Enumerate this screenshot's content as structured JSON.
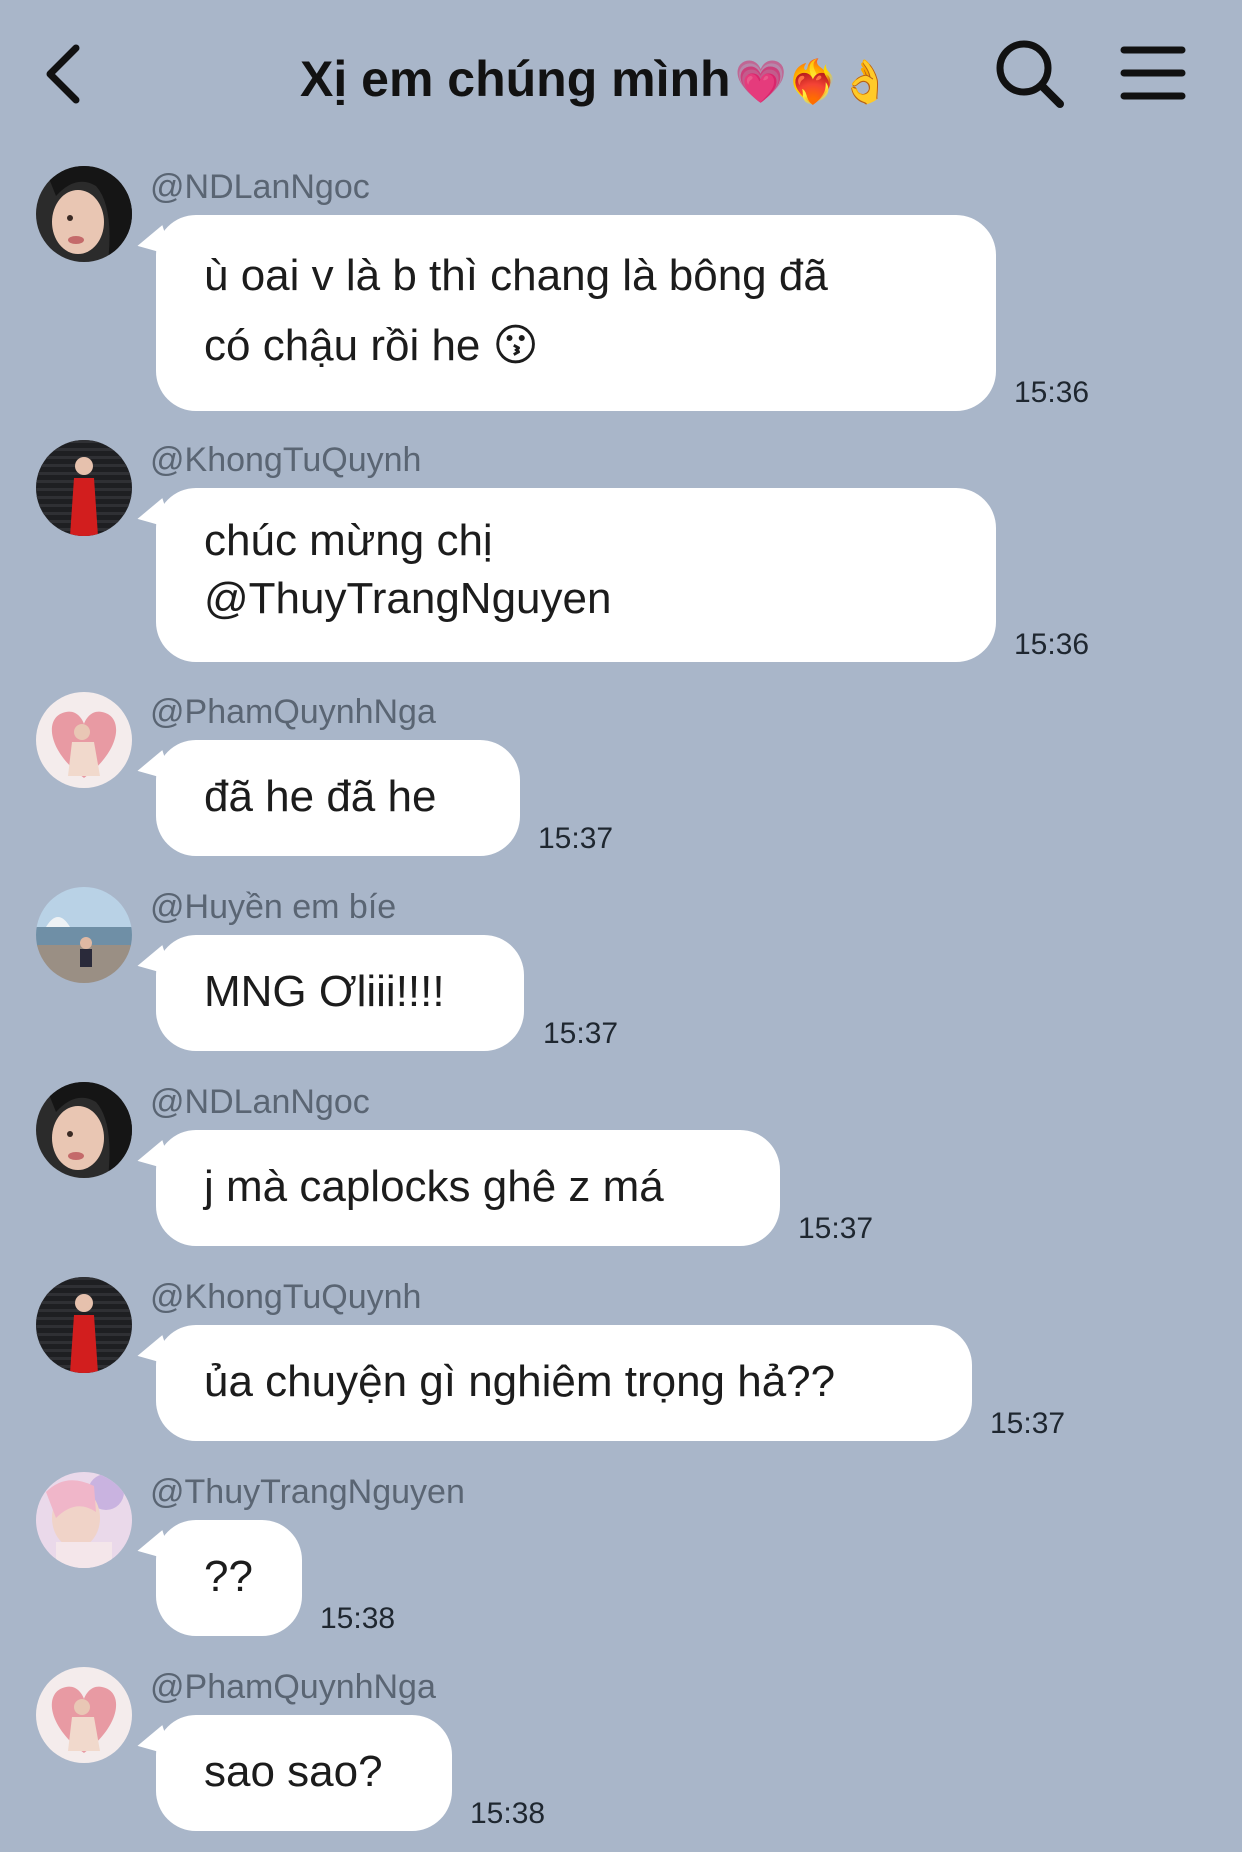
{
  "header": {
    "title": "Xị em chúng mình",
    "title_emojis": "💗❤️‍🔥👌"
  },
  "messages": [
    {
      "sender": "@NDLanNgoc",
      "lines": [
        "ù oai v là b thì chang là bông đã",
        "có chậu rồi he 😗"
      ],
      "time": "15:36"
    },
    {
      "sender": "@KhongTuQuynh",
      "lines": [
        "chúc mừng chị",
        "@ThuyTrangNguyen"
      ],
      "time": "15:36"
    },
    {
      "sender": "@PhamQuynhNga",
      "lines": [
        "đã he đã he"
      ],
      "time": "15:37"
    },
    {
      "sender": "@Huyền em bíe",
      "lines": [
        "MNG Ơliii!!!!"
      ],
      "time": "15:37"
    },
    {
      "sender": "@NDLanNgoc",
      "lines": [
        "j mà caplocks ghê z má"
      ],
      "time": "15:37"
    },
    {
      "sender": "@KhongTuQuynh",
      "lines": [
        "ủa chuyện gì nghiêm trọng hả??"
      ],
      "time": "15:37"
    },
    {
      "sender": "@ThuyTrangNguyen",
      "lines": [
        "??"
      ],
      "time": "15:38"
    },
    {
      "sender": "@PhamQuynhNga",
      "lines": [
        "sao sao?"
      ],
      "time": "15:38"
    }
  ],
  "icons": {
    "back": "chevron-left-icon",
    "search": "search-icon",
    "menu": "hamburger-menu-icon"
  }
}
